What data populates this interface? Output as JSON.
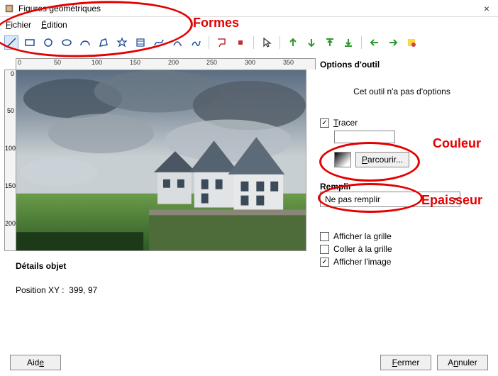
{
  "window": {
    "title": "Figures géométriques",
    "close_label": "×"
  },
  "menu": {
    "file": "Fichier",
    "edit": "Édition"
  },
  "ruler": {
    "h": [
      "0",
      "50",
      "100",
      "150",
      "200",
      "250",
      "300",
      "350"
    ],
    "v": [
      "0",
      "50",
      "100",
      "150",
      "200"
    ]
  },
  "options": {
    "title": "Options d'outil",
    "no_options_msg": "Cet outil n'a pas d'options",
    "tracer_label": "Tracer",
    "browse_label": "Parcourir...",
    "remplir_label": "Remplir",
    "remplir_value": "Ne pas remplir",
    "show_grid_label": "Afficher la grille",
    "snap_grid_label": "Coller à la grille",
    "show_image_label": "Afficher l'image",
    "tracer_checked": true,
    "show_grid_checked": false,
    "snap_grid_checked": false,
    "show_image_checked": true
  },
  "details": {
    "title": "Détails objet",
    "position_label": "Position XY :",
    "position_value": "399, 97"
  },
  "buttons": {
    "help": "Aide",
    "close": "Fermer",
    "cancel": "Annuler"
  },
  "annotations": {
    "formes": "Formes",
    "couleur": "Couleur",
    "epaisseur": "Epaisseur"
  }
}
